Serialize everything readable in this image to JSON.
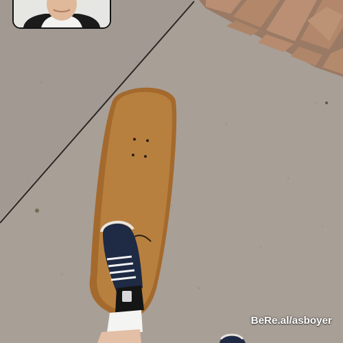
{
  "photo": {
    "watermark": "BeRe.al/asboyer",
    "subject_icon": "skateboard-foot-icon",
    "selfie_icon": "selfie-thumbnail-icon"
  },
  "colors": {
    "pavement": "#a79e96",
    "brick": "#b0876a",
    "deck": "#b27a3a",
    "shoe": "#1f2a44"
  }
}
